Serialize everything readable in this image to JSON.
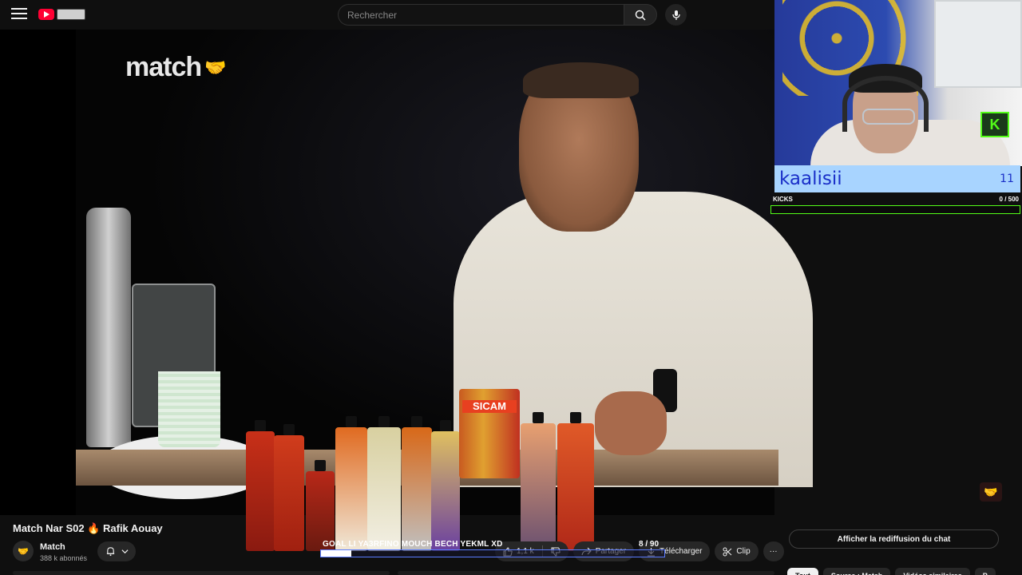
{
  "header": {
    "search_placeholder": "Rechercher"
  },
  "video": {
    "channel_logo_text": "match",
    "corner_logo": "handshake-logo"
  },
  "overlay": {
    "streamer_name": "kaalisii",
    "streamer_count": "11",
    "kicks_label": "KICKS",
    "kicks_progress": "0 / 500",
    "kicks_fraction": 0,
    "goal_text": "GOAL LI YA3RFINO MOUCH BECH YEKML XD",
    "goal_progress": "8 / 90",
    "goal_fraction": 0.089
  },
  "video_info": {
    "title": "Match Nar S02 🔥 Rafik Aouay",
    "channel_name": "Match",
    "subscribers": "388 k abonnés",
    "like_count": "1,1 k",
    "share_label": "Partager",
    "download_label": "Télécharger",
    "clip_label": "Clip",
    "more_label": "···"
  },
  "sidebar": {
    "chat_replay_label": "Afficher la rediffusion du chat",
    "chips": [
      "Tout",
      "Source : Match",
      "Vidéos similaires",
      "P"
    ]
  },
  "colors": {
    "accent_red": "#ff0033",
    "kick_green": "#53fc18",
    "name_bar_bg": "#a8d4ff",
    "name_text": "#1a2fc8"
  }
}
